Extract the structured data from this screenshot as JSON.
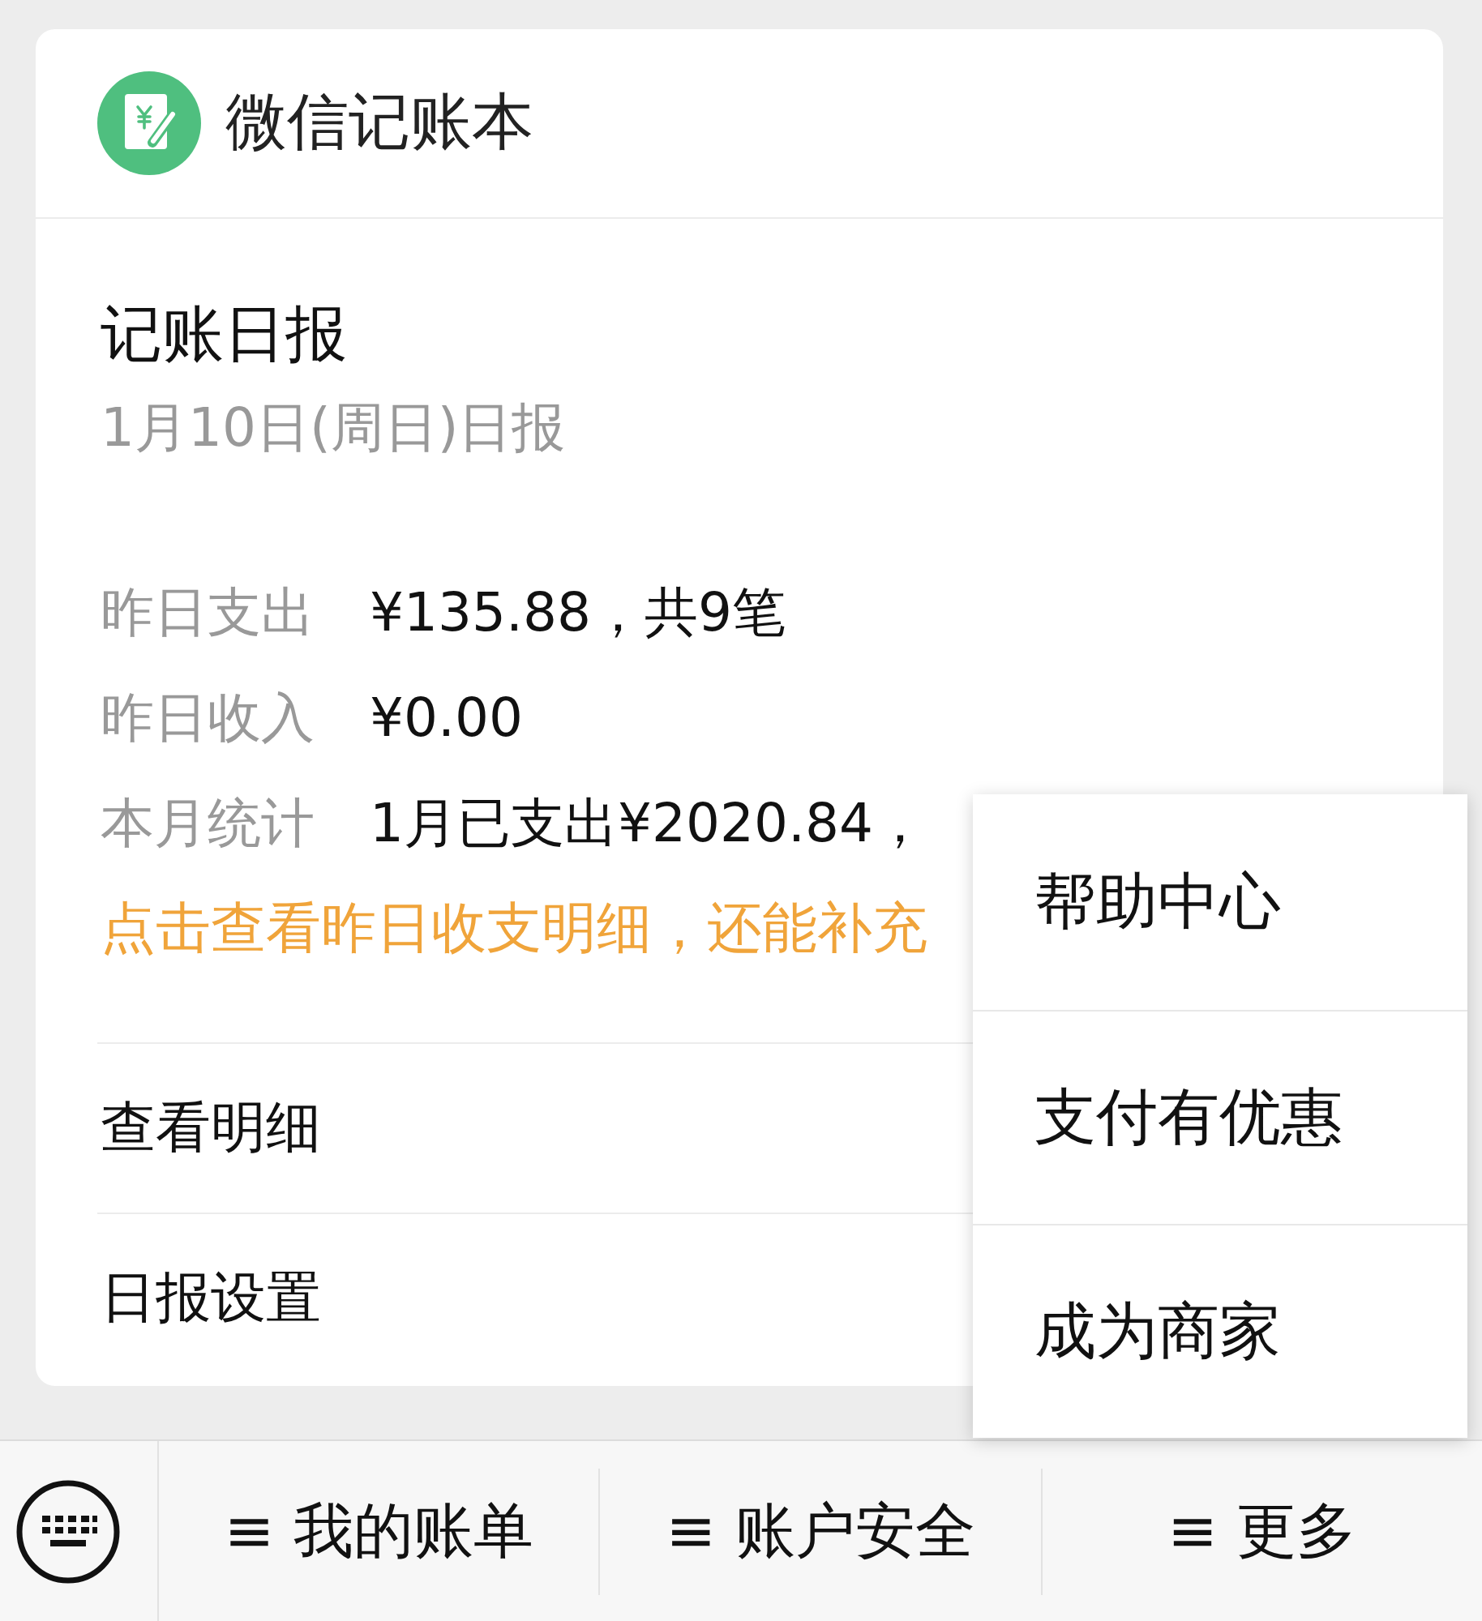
{
  "header": {
    "title": "微信记账本"
  },
  "report": {
    "title": "记账日报",
    "date": "1月10日(周日)日报",
    "stats": [
      {
        "label": "昨日支出",
        "value": "¥135.88，共9笔"
      },
      {
        "label": "昨日收入",
        "value": "¥0.00"
      },
      {
        "label": "本月统计",
        "value": "1月已支出¥2020.84，"
      }
    ],
    "hint": "点击查看昨日收支明细，还能补充"
  },
  "links": [
    "查看明细",
    "日报设置"
  ],
  "popup_menu": {
    "items": [
      "帮助中心",
      "支付有优惠",
      "成为商家"
    ]
  },
  "bottom_bar": {
    "tabs": [
      "≡ 我的账单",
      "≡ 账户安全",
      "≡ 更多"
    ]
  }
}
